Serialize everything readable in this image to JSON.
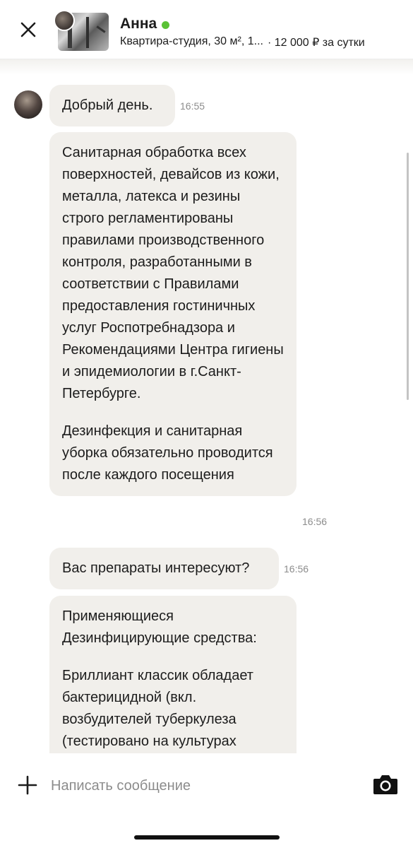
{
  "header": {
    "contact_name": "Анна",
    "online_color": "#5bc236",
    "listing_title": "Квартира-студия, 30 м², 1...",
    "listing_price": "· 12 000 ₽ за сутки",
    "close_icon": "close-icon"
  },
  "messages": [
    {
      "paragraphs": [
        "Добрый день."
      ],
      "time": "16:55"
    },
    {
      "paragraphs": [
        "Санитарная обработка всех поверхностей, девайсов из кожи, металла, латекса и резины строго регламентированы правилами производственного контроля, разработанными в соответствии с Правилами предоставления гостиничных услуг Роспотребнадзора и Рекомендациями Центра гигиены и эпидемиологии в г.Санкт-Петербурге.",
        "Дезинфекция и санитарная уборка обязательно проводится после каждого посещения"
      ],
      "time": "16:56"
    },
    {
      "paragraphs": [
        "Вас препараты интересуют?"
      ],
      "time": "16:56"
    },
    {
      "paragraphs": [
        "Применяющиеся Дезинфицирующие средства:",
        "Бриллиант классик обладает бактерицидной (вкл. возбудителей туберкулеза (тестировано на культурах"
      ],
      "time": ""
    }
  ],
  "composer": {
    "placeholder": "Написать сообщение",
    "add_icon": "plus-icon",
    "camera_icon": "camera-icon"
  },
  "colors": {
    "bubble": "#f1efeb",
    "text": "#1c1c1c",
    "muted": "#8c8c8c"
  }
}
